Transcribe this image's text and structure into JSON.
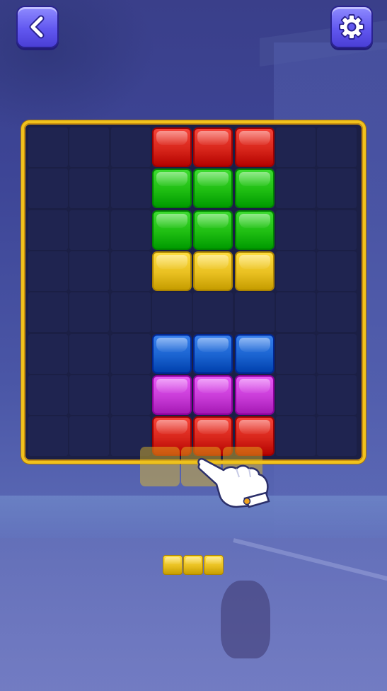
{
  "icons": {
    "back": "chevron-left-icon",
    "settings": "gear-icon",
    "hand": "pointing-hand-icon"
  },
  "colors": {
    "red": "#d8261b",
    "green": "#1fbe12",
    "yellow": "#e9c021",
    "blue": "#1a63d0",
    "purple": "#c93cd8",
    "frame": "#f1c21d",
    "empty_cell": "#1f2450"
  },
  "board": {
    "rows": 8,
    "cols": 8,
    "cells": [
      [
        null,
        null,
        null,
        "red",
        "red",
        "red",
        null,
        null
      ],
      [
        null,
        null,
        null,
        "green",
        "green",
        "green",
        null,
        null
      ],
      [
        null,
        null,
        null,
        "green",
        "green",
        "green",
        null,
        null
      ],
      [
        null,
        null,
        null,
        "yellow",
        "yellow",
        "yellow",
        null,
        null
      ],
      [
        null,
        null,
        null,
        null,
        null,
        null,
        null,
        null
      ],
      [
        null,
        null,
        null,
        "blue",
        "blue",
        "blue",
        null,
        null
      ],
      [
        null,
        null,
        null,
        "purple",
        "purple",
        "purple",
        null,
        null
      ],
      [
        null,
        null,
        null,
        "red",
        "red",
        "red",
        null,
        null
      ]
    ]
  },
  "dragging_piece": {
    "color": "yellow",
    "length": 3
  },
  "tray": {
    "pieces": [
      {
        "color": "yellow",
        "length": 3
      }
    ]
  }
}
